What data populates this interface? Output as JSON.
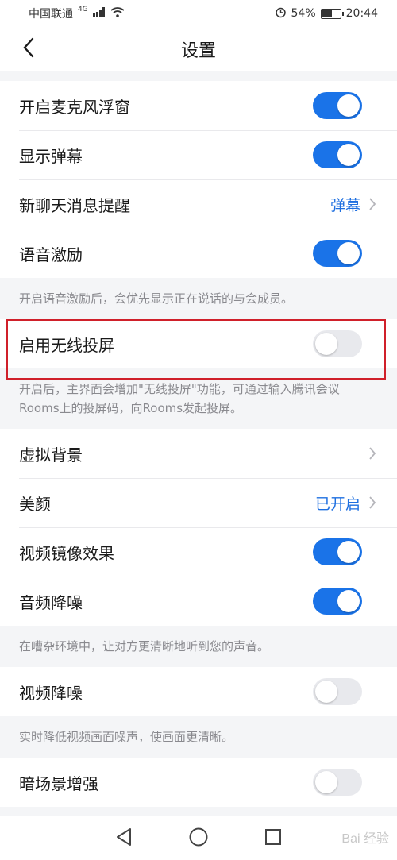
{
  "status_bar": {
    "carrier": "中国联通",
    "network": "4G",
    "battery": "54%",
    "time": "20:44"
  },
  "nav": {
    "title": "设置"
  },
  "rows": {
    "mic_float": {
      "label": "开启麦克风浮窗",
      "on": true
    },
    "danmu": {
      "label": "显示弹幕",
      "on": true
    },
    "new_chat": {
      "label": "新聊天消息提醒",
      "value": "弹幕"
    },
    "voice_excite": {
      "label": "语音激励",
      "on": true
    },
    "wireless": {
      "label": "启用无线投屏",
      "on": false
    },
    "virtual_bg": {
      "label": "虚拟背景"
    },
    "beauty": {
      "label": "美颜",
      "value": "已开启"
    },
    "mirror": {
      "label": "视频镜像效果",
      "on": true
    },
    "audio_denoise": {
      "label": "音频降噪",
      "on": true
    },
    "video_denoise": {
      "label": "视频降噪",
      "on": false
    },
    "dark_enhance": {
      "label": "暗场景增强",
      "on": false
    }
  },
  "hints": {
    "voice_excite": "开启语音激励后，会优先显示正在说话的与会成员。",
    "wireless": "开启后，主界面会增加\"无线投屏\"功能，可通过输入腾讯会议Rooms上的投屏码，向Rooms发起投屏。",
    "audio_denoise": "在嘈杂环境中，让对方更清晰地听到您的声音。",
    "video_denoise": "实时降低视频画面噪声，使画面更清晰。"
  },
  "watermark": "Bai 经验",
  "colors": {
    "accent": "#1a73e8",
    "value_text": "#1e6fe0",
    "highlight": "#d0202a"
  },
  "icons": {
    "back": "chevron-left-icon",
    "chevron": "chevron-right-icon",
    "nav_back": "triangle-back-icon",
    "nav_home": "circle-home-icon",
    "nav_recent": "square-recent-icon"
  }
}
